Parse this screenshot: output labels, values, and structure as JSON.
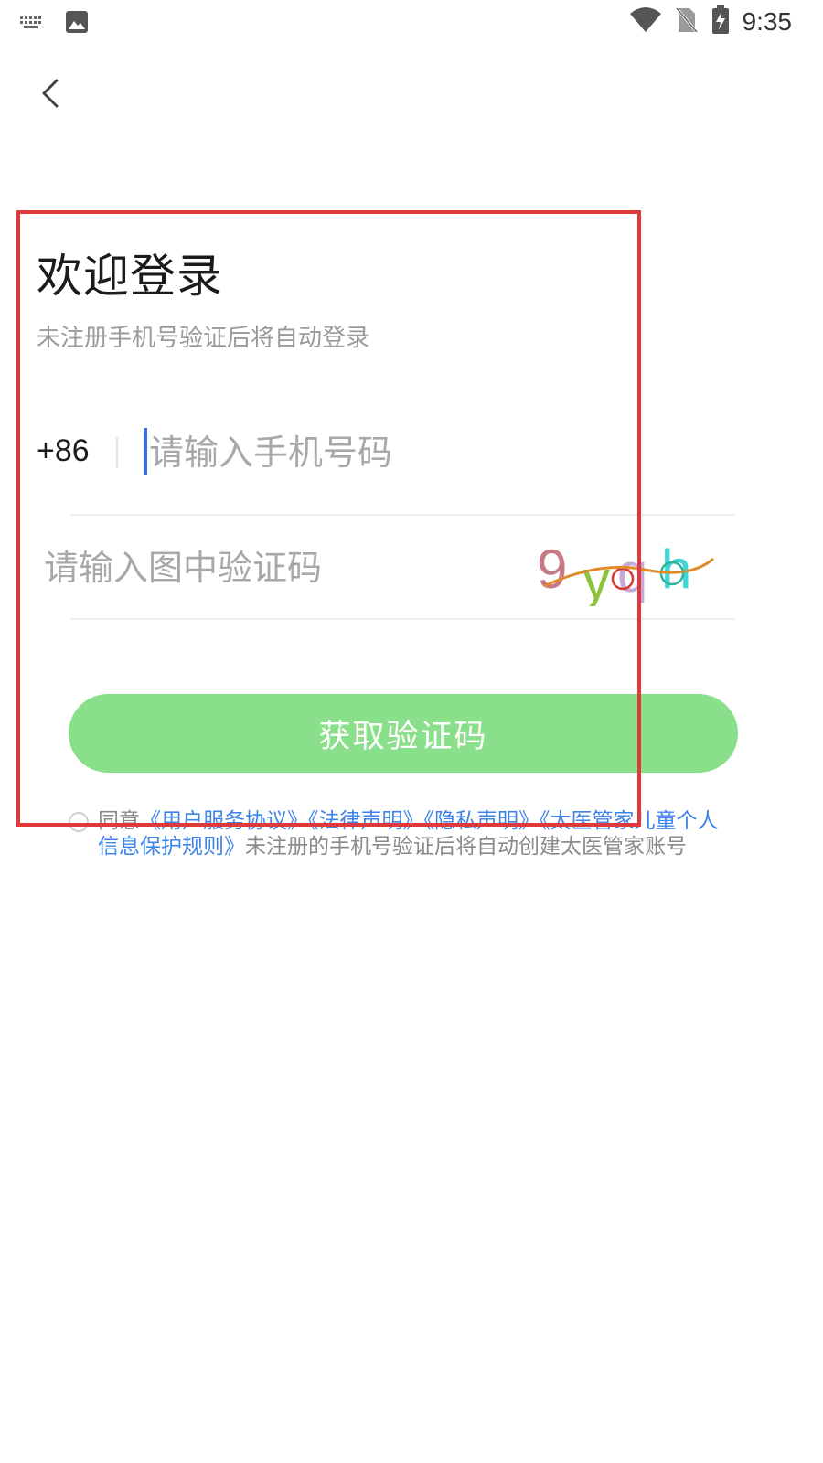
{
  "status_bar": {
    "time": "9:35"
  },
  "header": {
    "back_icon": "chevron-left-icon"
  },
  "login": {
    "title": "欢迎登录",
    "subtitle": "未注册手机号验证后将自动登录",
    "country_code": "+86",
    "phone_placeholder": "请输入手机号码",
    "captcha_placeholder": "请输入图中验证码",
    "captcha_text": "9yqh",
    "get_code_button": "获取验证码"
  },
  "agreement": {
    "prefix": "同意",
    "links": [
      "《用户服务协议》",
      "《法律声明》",
      "《隐私声明》",
      "《太医管家儿童个人信息保护规则》"
    ],
    "suffix": "未注册的手机号验证后将自动创建太医管家账号"
  },
  "colors": {
    "accent_green": "#8adf8a",
    "link_blue": "#3e84e8",
    "caret_blue": "#3b6fe8",
    "highlight_red": "#e0393b"
  }
}
